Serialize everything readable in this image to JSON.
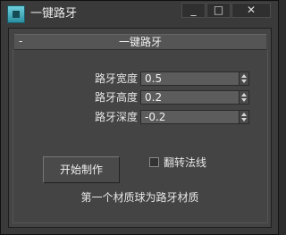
{
  "window": {
    "title": "一键路牙",
    "icon": "app-icon",
    "controls": {
      "minimize": "_",
      "maximize": "□",
      "close": "✕"
    }
  },
  "rollout": {
    "toggle": "-",
    "title": "一键路牙"
  },
  "params": [
    {
      "label": "路牙宽度",
      "value": "0.5"
    },
    {
      "label": "路牙高度",
      "value": "0.2"
    },
    {
      "label": "路牙深度",
      "value": "-0.2"
    }
  ],
  "actions": {
    "start_label": "开始制作"
  },
  "options": {
    "flip_normals_label": "翻转法线",
    "flip_normals_checked": false
  },
  "note": "第一个材质球为路牙材质",
  "colors": {
    "window_bg": "#3a3a3a",
    "panel_bg": "#444444",
    "text": "#e6e6e6"
  }
}
